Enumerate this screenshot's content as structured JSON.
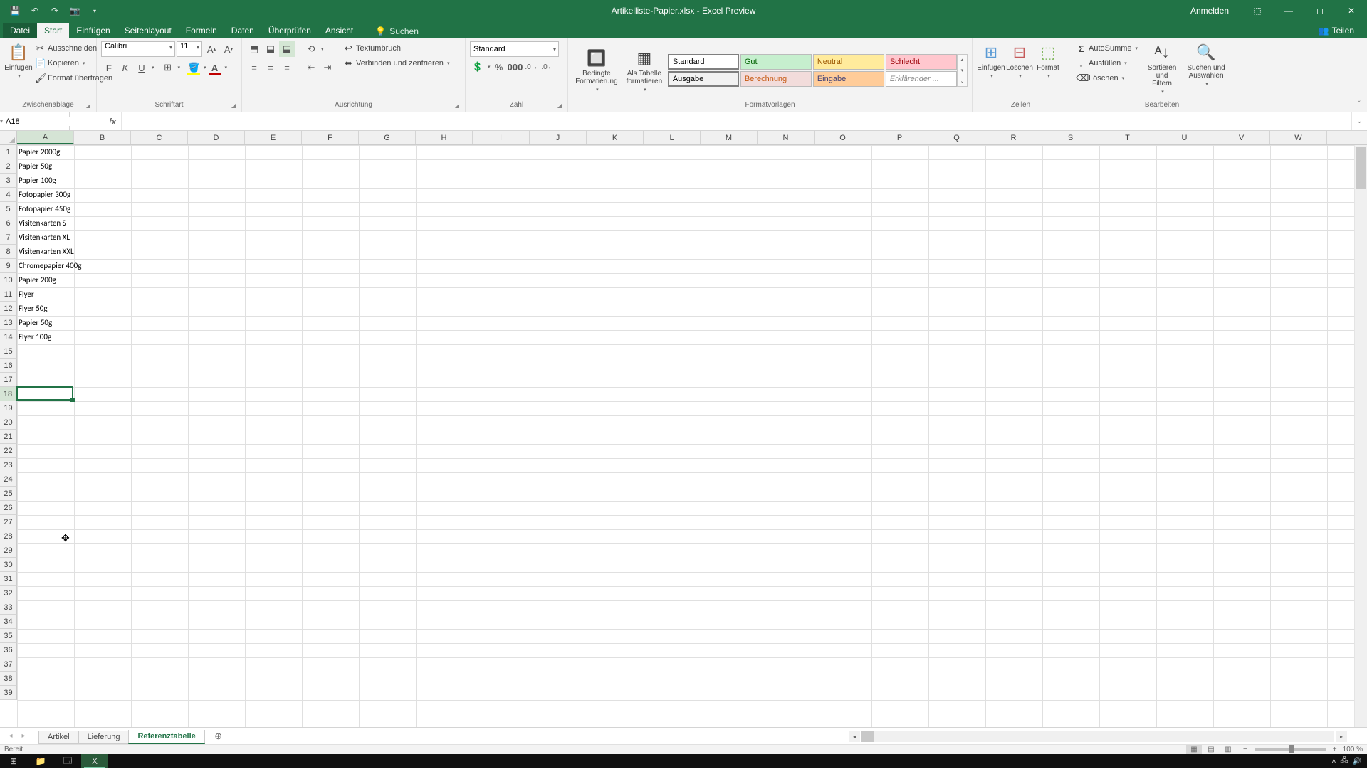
{
  "title": "Artikelliste-Papier.xlsx - Excel Preview",
  "signin_label": "Anmelden",
  "tabs": {
    "file": "Datei",
    "start": "Start",
    "einf": "Einfügen",
    "layout": "Seitenlayout",
    "formeln": "Formeln",
    "daten": "Daten",
    "pruef": "Überprüfen",
    "ansicht": "Ansicht",
    "suchen": "Suchen",
    "teilen": "Teilen"
  },
  "clipboard": {
    "paste": "Einfügen",
    "cut": "Ausschneiden",
    "copy": "Kopieren",
    "format": "Format übertragen",
    "group": "Zwischenablage"
  },
  "font": {
    "name": "Calibri",
    "size": "11",
    "group": "Schriftart"
  },
  "align": {
    "wrap": "Textumbruch",
    "merge": "Verbinden und zentrieren",
    "group": "Ausrichtung"
  },
  "number": {
    "format": "Standard",
    "group": "Zahl"
  },
  "styles": {
    "cond": "Bedingte\nFormatierung",
    "table": "Als Tabelle\nformatieren",
    "standard": "Standard",
    "gut": "Gut",
    "neutral": "Neutral",
    "schlecht": "Schlecht",
    "ausgabe": "Ausgabe",
    "berechnung": "Berechnung",
    "eingabe": "Eingabe",
    "erkl": "Erklärender ...",
    "group": "Formatvorlagen"
  },
  "cells": {
    "insert": "Einfügen",
    "delete": "Löschen",
    "format": "Format",
    "group": "Zellen"
  },
  "editing": {
    "autosum": "AutoSumme",
    "fill": "Ausfüllen",
    "clear": "Löschen",
    "sort": "Sortieren und\nFiltern",
    "find": "Suchen und\nAuswählen",
    "group": "Bearbeiten"
  },
  "name_box": "A18",
  "columns": [
    "A",
    "B",
    "C",
    "D",
    "E",
    "F",
    "G",
    "H",
    "I",
    "J",
    "K",
    "L",
    "M",
    "N",
    "O",
    "P",
    "Q",
    "R",
    "S",
    "T",
    "U",
    "V",
    "W"
  ],
  "rows": [
    "1",
    "2",
    "3",
    "4",
    "5",
    "6",
    "7",
    "8",
    "9",
    "10",
    "11",
    "12",
    "13",
    "14",
    "15",
    "16",
    "17",
    "18",
    "19",
    "20",
    "21",
    "22",
    "23",
    "24",
    "25",
    "26",
    "27",
    "28",
    "29",
    "30",
    "31",
    "32",
    "33",
    "34",
    "35",
    "36",
    "37",
    "38",
    "39"
  ],
  "cells_data": [
    "Papier 2000g",
    "Papier 50g",
    "Papier 100g",
    "Fotopapier 300g",
    "Fotopapier 450g",
    "Visitenkarten S",
    "Visitenkarten XL",
    "Visitenkarten XXL",
    "Chromepapier 400g",
    "Papier 200g",
    "Flyer",
    "Flyer 50g",
    "Papier 50g",
    "Flyer 100g"
  ],
  "active_row_index": 17,
  "sheets": {
    "artikel": "Artikel",
    "lieferung": "Lieferung",
    "referenz": "Referenztabelle"
  },
  "status": {
    "ready": "Bereit",
    "zoom": "100 %"
  }
}
